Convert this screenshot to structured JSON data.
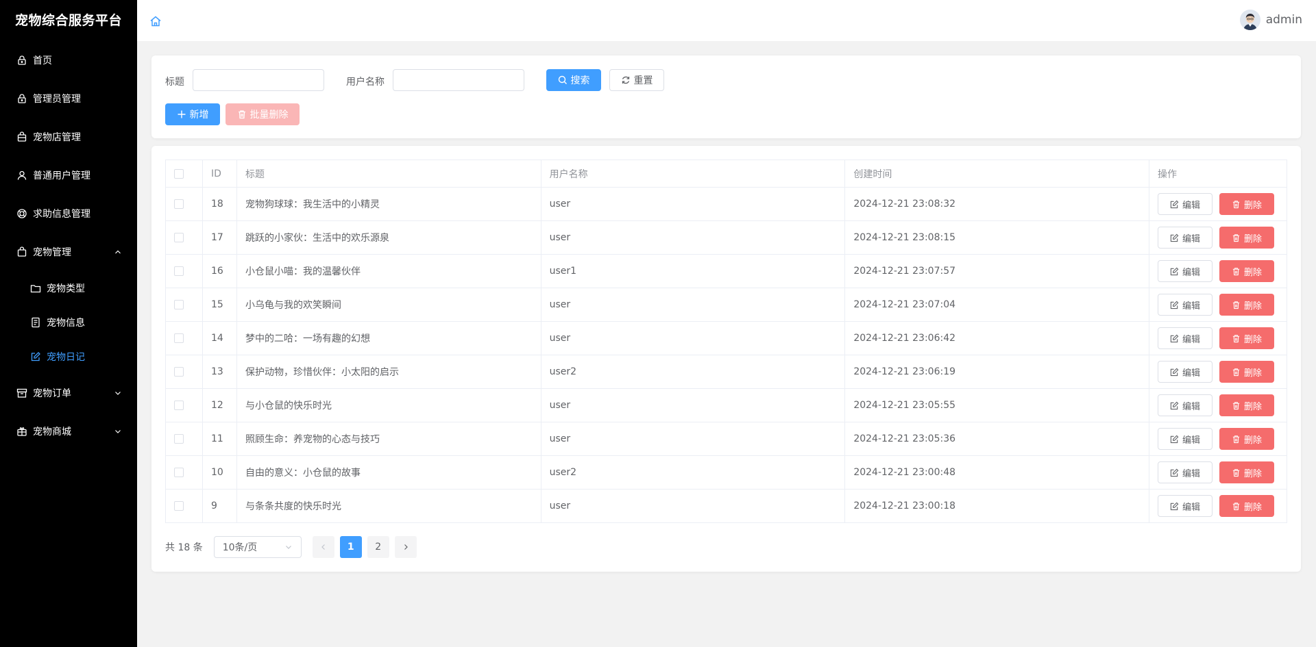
{
  "sidebar": {
    "brand": "宠物综合服务平台",
    "items": [
      {
        "label": "首页",
        "icon": "lock-icon"
      },
      {
        "label": "管理员管理",
        "icon": "lock-icon"
      },
      {
        "label": "宠物店管理",
        "icon": "shop-bag-icon"
      },
      {
        "label": "普通用户管理",
        "icon": "user-icon"
      },
      {
        "label": "求助信息管理",
        "icon": "help-ring-icon"
      },
      {
        "label": "宠物管理",
        "icon": "bag-icon",
        "expanded": true
      },
      {
        "label": "宠物订单",
        "icon": "box-icon",
        "expanded": false
      },
      {
        "label": "宠物商城",
        "icon": "gift-icon",
        "expanded": false
      }
    ],
    "sub_items": [
      {
        "label": "宠物类型",
        "icon": "folder-icon"
      },
      {
        "label": "宠物信息",
        "icon": "document-icon"
      },
      {
        "label": "宠物日记",
        "icon": "edit-icon",
        "active": true
      }
    ]
  },
  "header": {
    "username": "admin"
  },
  "search": {
    "title_label": "标题",
    "title_value": "",
    "user_label": "用户名称",
    "user_value": "",
    "search_button": "搜索",
    "reset_button": "重置",
    "add_button": "新增",
    "batch_delete_button": "批量删除"
  },
  "table": {
    "columns": [
      "ID",
      "标题",
      "用户名称",
      "创建时间",
      "操作"
    ],
    "edit_label": "编辑",
    "delete_label": "删除",
    "rows": [
      {
        "id": "18",
        "title": "宠物狗球球：我生活中的小精灵",
        "user": "user",
        "created": "2024-12-21 23:08:32"
      },
      {
        "id": "17",
        "title": "跳跃的小家伙：生活中的欢乐源泉",
        "user": "user",
        "created": "2024-12-21 23:08:15"
      },
      {
        "id": "16",
        "title": "小仓鼠小喵：我的温馨伙伴",
        "user": "user1",
        "created": "2024-12-21 23:07:57"
      },
      {
        "id": "15",
        "title": "小乌龟与我的欢笑瞬间",
        "user": "user",
        "created": "2024-12-21 23:07:04"
      },
      {
        "id": "14",
        "title": "梦中的二哈：一场有趣的幻想",
        "user": "user",
        "created": "2024-12-21 23:06:42"
      },
      {
        "id": "13",
        "title": "保护动物，珍惜伙伴：小太阳的启示",
        "user": "user2",
        "created": "2024-12-21 23:06:19"
      },
      {
        "id": "12",
        "title": "与小仓鼠的快乐时光",
        "user": "user",
        "created": "2024-12-21 23:05:55"
      },
      {
        "id": "11",
        "title": "照顾生命：养宠物的心态与技巧",
        "user": "user",
        "created": "2024-12-21 23:05:36"
      },
      {
        "id": "10",
        "title": "自由的意义：小仓鼠的故事",
        "user": "user2",
        "created": "2024-12-21 23:00:48"
      },
      {
        "id": "9",
        "title": "与条条共度的快乐时光",
        "user": "user",
        "created": "2024-12-21 23:00:18"
      }
    ]
  },
  "pagination": {
    "total_text": "共 18 条",
    "page_size": "10条/页",
    "pages": [
      "1",
      "2"
    ],
    "current": "1"
  },
  "colors": {
    "primary": "#409eff",
    "danger": "#f56c6c",
    "sidebar_bg": "#000000"
  }
}
